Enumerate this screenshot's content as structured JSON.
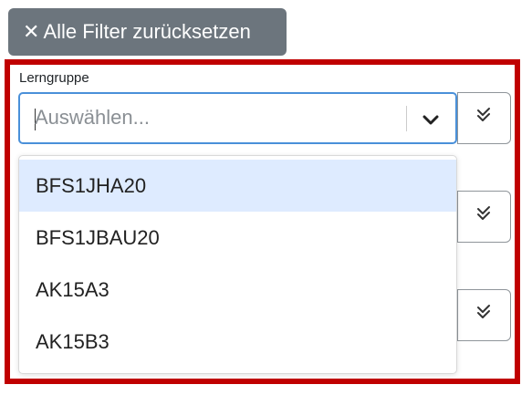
{
  "reset_button": {
    "icon": "close-icon",
    "label": "Alle Filter zurücksetzen"
  },
  "filter": {
    "label": "Lerngruppe",
    "placeholder": "Auswählen..."
  },
  "dropdown": {
    "options": [
      {
        "label": "BFS1JHA20",
        "highlighted": true
      },
      {
        "label": "BFS1JBAU20",
        "highlighted": false
      },
      {
        "label": "AK15A3",
        "highlighted": false
      },
      {
        "label": "AK15B3",
        "highlighted": false
      }
    ]
  },
  "colors": {
    "reset_bg": "#6c757d",
    "panel_border": "#c00000",
    "focus_border": "#4a90d9",
    "highlight": "#deebff"
  }
}
